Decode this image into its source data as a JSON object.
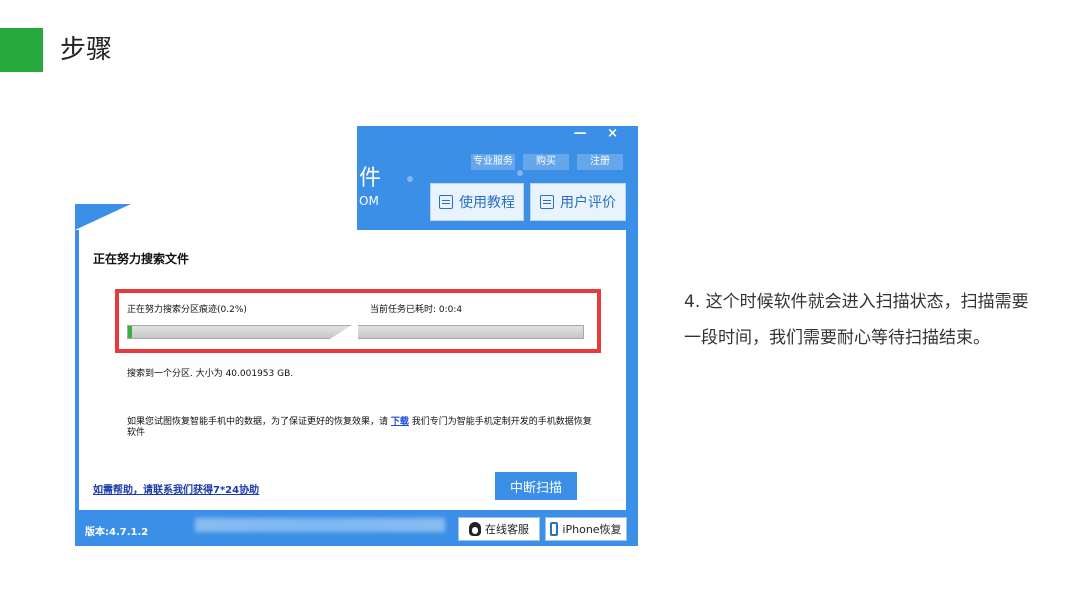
{
  "slide": {
    "title": "步骤",
    "accent_color": "#27a93e"
  },
  "app": {
    "window_controls": "— ×",
    "top_links": [
      "专业服务",
      "购买",
      "注册"
    ],
    "brand_fragment_1": "件",
    "brand_fragment_2": "OM",
    "tutorial_button": "使用教程",
    "review_button": "用户评价",
    "dialog_title": "正在努力搜索文件",
    "scan_status": "正在努力搜索分区痕迹(0.2%)",
    "elapsed": "当前任务已耗时: 0:0:4",
    "progress_fraction": 0.002,
    "found_text": "搜索到一个分区. 大小为 40.001953 GB.",
    "tip_before": "如果您试图恢复智能手机中的数据，为了保证更好的恢复效果，请",
    "tip_link": "下载",
    "tip_after": "我们专门为智能手机定制开发的手机数据恢复软件",
    "help_link": "如需帮助，请联系我们获得7*24协助",
    "stop_button": "中断扫描",
    "version": "版本:4.7.1.2",
    "online_service": "在线客服",
    "iphone_recovery": "iPhone恢复",
    "brand_color": "#3b8fe6",
    "highlight_color": "#e8393c",
    "icons": [
      "document-icon",
      "comment-icon",
      "qq-penguin-icon",
      "phone-icon"
    ]
  },
  "description": "4. 这个时候软件就会进入扫描状态，扫描需要一段时间，我们需要耐心等待扫描结束。"
}
